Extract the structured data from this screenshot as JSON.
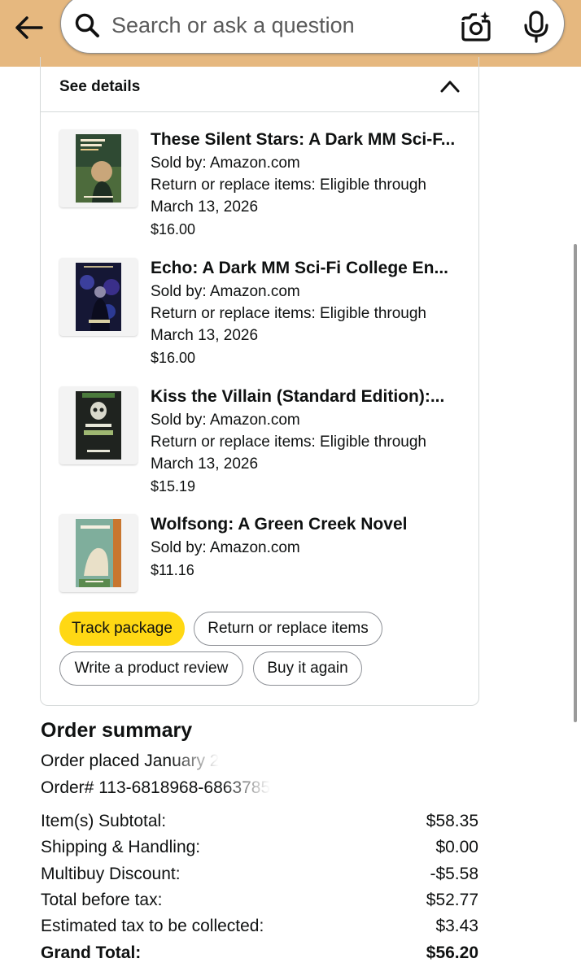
{
  "search": {
    "placeholder": "Search or ask a question"
  },
  "details": {
    "toggle_label": "See details"
  },
  "items": [
    {
      "title": "These Silent Stars: A Dark MM Sci-F...",
      "sold_by": "Sold by: Amazon.com",
      "return_line1": "Return or replace items: Eligible through",
      "return_line2": "March 13, 2026",
      "price": "$16.00",
      "cover_color": "#3d5a3a"
    },
    {
      "title": "Echo: A Dark MM Sci-Fi College En...",
      "sold_by": "Sold by: Amazon.com",
      "return_line1": "Return or replace items: Eligible through",
      "return_line2": "March 13, 2026",
      "price": "$16.00",
      "cover_color": "#1c1f4a"
    },
    {
      "title": "Kiss the Villain (Standard Edition):...",
      "sold_by": "Sold by: Amazon.com",
      "return_line1": "Return or replace items: Eligible through",
      "return_line2": "March 13, 2026",
      "price": "$15.19",
      "cover_color": "#2a2f2a"
    },
    {
      "title": "Wolfsong: A Green Creek Novel",
      "sold_by": "Sold by: Amazon.com",
      "price": "$11.16",
      "cover_color": "#6e9c8e"
    }
  ],
  "buttons": {
    "track": "Track package",
    "return": "Return or replace items",
    "review": "Write a product review",
    "buy_again": "Buy it again"
  },
  "summary": {
    "title": "Order summary",
    "order_placed": "Order placed January 2",
    "order_number": "Order# 113-6818968-6863785",
    "rows": [
      {
        "label": "Item(s) Subtotal:",
        "value": "$58.35"
      },
      {
        "label": "Shipping & Handling:",
        "value": "$0.00"
      },
      {
        "label": "Multibuy Discount:",
        "value": "-$5.58"
      },
      {
        "label": "Total before tax:",
        "value": "$52.77"
      },
      {
        "label": "Estimated tax to be collected:",
        "value": "$3.43"
      },
      {
        "label": "Grand Total:",
        "value": "$56.20"
      }
    ]
  },
  "colors": {
    "header_bg": "#e6b87f",
    "primary_button": "#ffd814",
    "border": "#d5d9d9"
  }
}
